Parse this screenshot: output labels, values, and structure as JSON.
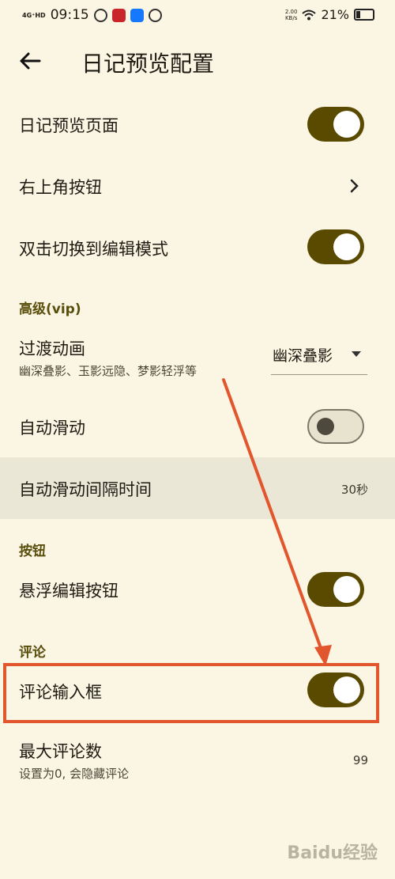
{
  "status_bar": {
    "network": "4G⁺HD",
    "time": "09:15",
    "speed_value": "2.00",
    "speed_unit": "KB/s",
    "battery_text": "21%",
    "battery_level": 0.21
  },
  "header": {
    "title": "日记预览配置"
  },
  "rows": {
    "diary_preview_page": {
      "label": "日记预览页面",
      "enabled": true
    },
    "top_right_button": {
      "label": "右上角按钮"
    },
    "double_tap_edit": {
      "label": "双击切换到编辑模式",
      "enabled": true
    },
    "transition_animation": {
      "label": "过渡动画",
      "subtitle": "幽深叠影、玉影远隐、梦影轻浮等",
      "selected": "幽深叠影"
    },
    "auto_scroll": {
      "label": "自动滑动",
      "enabled": false
    },
    "auto_scroll_interval": {
      "label": "自动滑动间隔时间",
      "value": "30秒"
    },
    "floating_edit_button": {
      "label": "悬浮编辑按钮",
      "enabled": true
    },
    "comment_input": {
      "label": "评论输入框",
      "enabled": true
    },
    "max_comments": {
      "label": "最大评论数",
      "subtitle": "设置为0, 会隐藏评论",
      "value": "99"
    }
  },
  "sections": {
    "advanced": "高级(vip)",
    "buttons": "按钮",
    "comments": "评论"
  },
  "watermark": "Baidu经验",
  "colors": {
    "background": "#fbf6e4",
    "accent": "#5a4a00",
    "section_title": "#5a4e0d",
    "annotation": "#e2562d"
  }
}
